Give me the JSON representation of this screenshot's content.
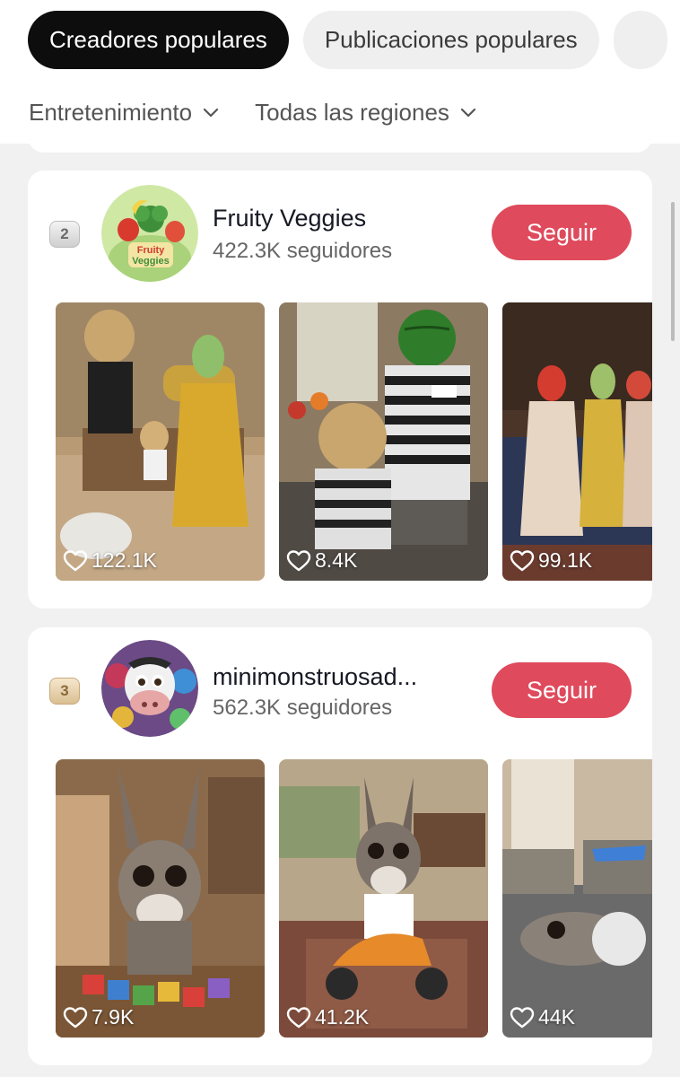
{
  "tabs": [
    {
      "label": "Creadores populares",
      "active": true
    },
    {
      "label": "Publicaciones populares",
      "active": false
    }
  ],
  "filters": {
    "category": "Entretenimiento",
    "region": "Todas las regiones"
  },
  "creators": [
    {
      "rank": "2",
      "name": "Fruity Veggies",
      "followers": "422.3K seguidores",
      "follow_label": "Seguir",
      "avatar_text": [
        "Fruity",
        "Veggies"
      ],
      "posts": [
        {
          "likes": "122.1K"
        },
        {
          "likes": "8.4K"
        },
        {
          "likes": "99.1K"
        }
      ]
    },
    {
      "rank": "3",
      "name": "minimonstruosad...",
      "followers": "562.3K seguidores",
      "follow_label": "Seguir",
      "posts": [
        {
          "likes": "7.9K"
        },
        {
          "likes": "41.2K"
        },
        {
          "likes": "44K"
        }
      ]
    }
  ],
  "colors": {
    "follow_button": "#df4a5c",
    "active_tab": "#0d0d0d",
    "page_background": "#f1f1f2"
  }
}
